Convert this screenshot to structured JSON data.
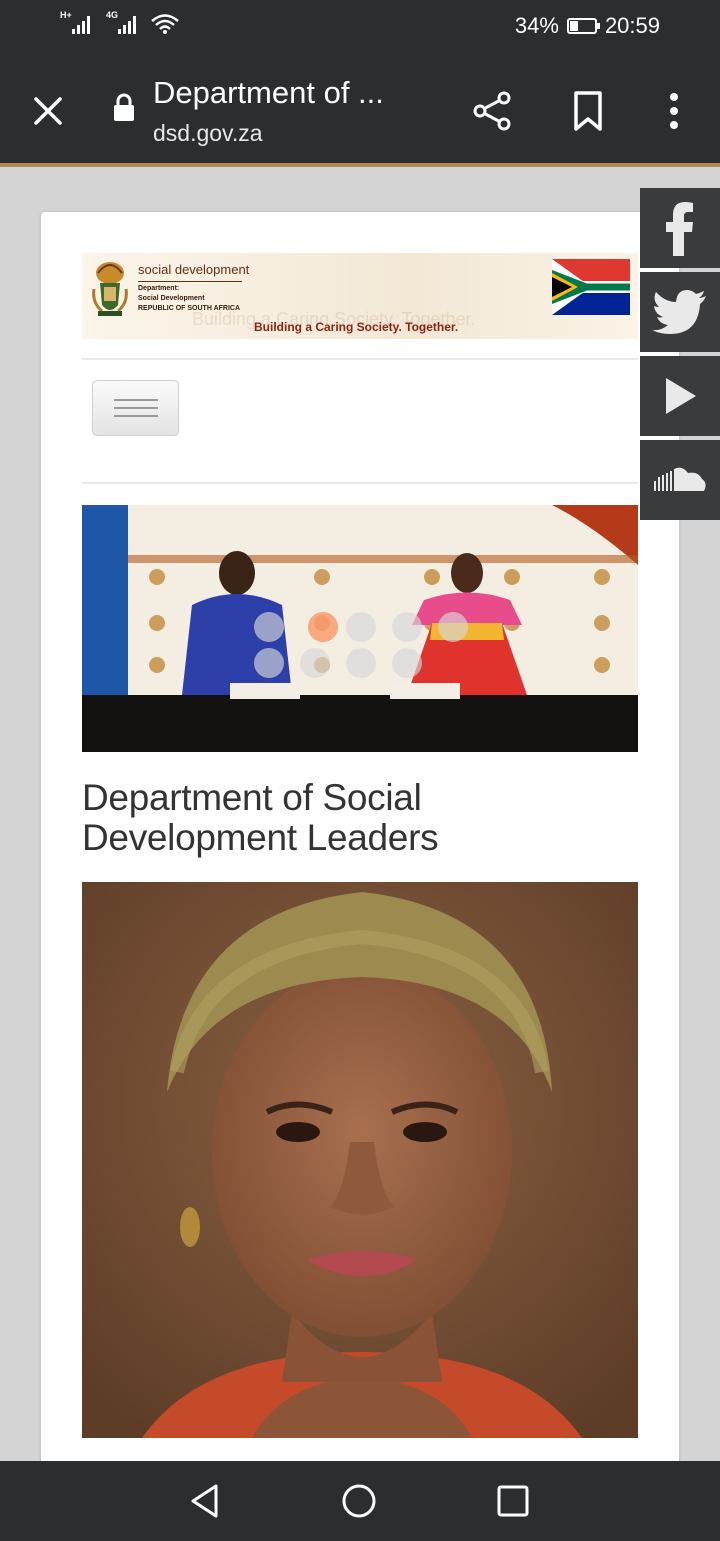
{
  "status_bar": {
    "network_1": "H+",
    "network_2": "4G",
    "battery": "34%",
    "battery_level": 0.34,
    "time": "20:59"
  },
  "browser": {
    "title": "Department of ...",
    "url": "dsd.gov.za"
  },
  "site": {
    "department_name": "social development",
    "department_line_1": "Department:",
    "department_line_2": "Social Development",
    "department_line_3": "REPUBLIC OF SOUTH AFRICA",
    "slogan": "Building a Caring Society. Together.",
    "menu_button_lines": 3
  },
  "slideshow": {
    "dot_count": 9,
    "active_dot": 2
  },
  "article": {
    "headline": "Department of Social Development Leaders"
  },
  "social_links": [
    {
      "name": "facebook-icon"
    },
    {
      "name": "twitter-icon"
    },
    {
      "name": "youtube-icon"
    },
    {
      "name": "soundcloud-icon"
    }
  ],
  "nav_bar": {
    "buttons": [
      "back-icon",
      "home-icon",
      "recents-icon"
    ]
  },
  "colors": {
    "browser_chrome": "#2b2d2f",
    "toolbar_accent": "#b08a52",
    "social_bar": "#3a3b3d",
    "slogan": "#8a2410"
  }
}
